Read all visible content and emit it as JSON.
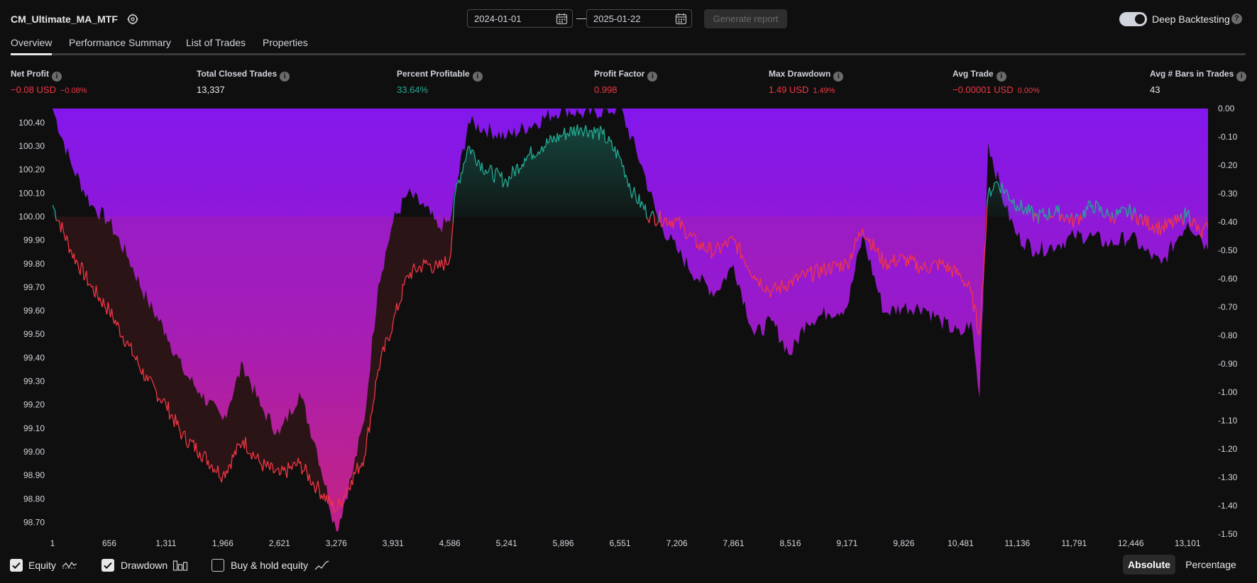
{
  "header": {
    "strategy_name": "CM_Ultimate_MA_MTF",
    "date_from": "2024-01-01",
    "date_separator": "—",
    "date_to": "2025-01-22",
    "generate_label": "Generate report",
    "deep_backtesting_label": "Deep Backtesting",
    "deep_backtesting_on": true
  },
  "tabs": [
    {
      "label": "Overview",
      "active": true
    },
    {
      "label": "Performance Summary",
      "active": false
    },
    {
      "label": "List of Trades",
      "active": false
    },
    {
      "label": "Properties",
      "active": false
    }
  ],
  "metrics": {
    "net_profit": {
      "label": "Net Profit",
      "value": "−0.08 USD",
      "sub": "−0.08%"
    },
    "total_closed_trades": {
      "label": "Total Closed Trades",
      "value": "13,337"
    },
    "percent_profitable": {
      "label": "Percent Profitable",
      "value": "33.64%"
    },
    "profit_factor": {
      "label": "Profit Factor",
      "value": "0.998"
    },
    "max_drawdown": {
      "label": "Max Drawdown",
      "value": "1.49 USD",
      "sub": "1.49%"
    },
    "avg_trade": {
      "label": "Avg Trade",
      "value": "−0.00001 USD",
      "sub": "0.00%"
    },
    "avg_bars": {
      "label": "Avg # Bars in Trades",
      "value": "43"
    }
  },
  "colors": {
    "equity_up": "#22ab94",
    "equity_down": "#f23645",
    "drawdown": "#8317ec",
    "background": "#0f0f0f"
  },
  "chart_data": {
    "type": "area",
    "left_axis_ticks": [
      "100.40",
      "100.30",
      "100.20",
      "100.10",
      "100.00",
      "99.90",
      "99.80",
      "99.70",
      "99.60",
      "99.50",
      "99.40",
      "99.30",
      "99.20",
      "99.10",
      "99.00",
      "98.90",
      "98.80",
      "98.70"
    ],
    "right_axis_ticks": [
      "0.00",
      "-0.10",
      "-0.20",
      "-0.30",
      "-0.40",
      "-0.50",
      "-0.60",
      "-0.70",
      "-0.80",
      "-0.90",
      "-1.00",
      "-1.10",
      "-1.20",
      "-1.30",
      "-1.40",
      "-1.50"
    ],
    "x_ticks": [
      "1",
      "656",
      "1,311",
      "1,966",
      "2,621",
      "3,276",
      "3,931",
      "4,586",
      "5,241",
      "5,896",
      "6,551",
      "7,206",
      "7,861",
      "8,516",
      "9,171",
      "9,826",
      "10,481",
      "11,136",
      "11,791",
      "12,446",
      "13,101"
    ],
    "equity_ylim": [
      98.65,
      100.46
    ],
    "drawdown_ylim": [
      -1.5,
      0
    ],
    "baseline": 100.0,
    "series": [
      {
        "name": "Equity",
        "x": [
          1,
          220,
          450,
          656,
          880,
          1100,
          1311,
          1500,
          1700,
          1966,
          2200,
          2400,
          2621,
          2850,
          3050,
          3276,
          3450,
          3600,
          3760,
          3931,
          4100,
          4300,
          4450,
          4586,
          4650,
          4800,
          5000,
          5241,
          5450,
          5650,
          5896,
          6100,
          6350,
          6551,
          6700,
          6900,
          7206,
          7450,
          7650,
          7861,
          8100,
          8300,
          8516,
          8700,
          8950,
          9171,
          9350,
          9600,
          9826,
          10050,
          10250,
          10481,
          10600,
          10700,
          10800,
          10900,
          11136,
          11350,
          11600,
          11791,
          12000,
          12200,
          12446,
          12600,
          12800,
          13000,
          13101,
          13250,
          13337
        ],
        "y": [
          100.05,
          99.85,
          99.7,
          99.6,
          99.45,
          99.3,
          99.2,
          99.07,
          99.0,
          98.9,
          99.05,
          98.95,
          98.9,
          98.95,
          98.85,
          98.75,
          98.88,
          98.98,
          99.35,
          99.55,
          99.75,
          99.8,
          99.78,
          99.82,
          100.1,
          100.3,
          100.2,
          100.15,
          100.25,
          100.3,
          100.35,
          100.38,
          100.35,
          100.25,
          100.1,
          100.0,
          99.98,
          99.88,
          99.85,
          99.9,
          99.75,
          99.68,
          99.72,
          99.75,
          99.78,
          99.8,
          99.95,
          99.8,
          99.82,
          99.78,
          99.8,
          99.75,
          99.68,
          99.5,
          100.1,
          100.15,
          100.05,
          100.0,
          100.02,
          99.98,
          100.05,
          100.0,
          100.02,
          99.98,
          99.95,
          99.98,
          100.02,
          99.92,
          99.95
        ]
      },
      {
        "name": "Drawdown",
        "x": [
          1,
          220,
          450,
          656,
          880,
          1100,
          1311,
          1500,
          1700,
          1966,
          2200,
          2400,
          2621,
          2850,
          3050,
          3276,
          3450,
          3600,
          3760,
          3931,
          4100,
          4300,
          4450,
          4586,
          4800,
          5241,
          5896,
          6100,
          6551,
          6800,
          7000,
          7206,
          7450,
          7650,
          7861,
          8100,
          8300,
          8516,
          8700,
          8950,
          9171,
          9350,
          9600,
          9826,
          10050,
          10250,
          10481,
          10600,
          10700,
          10800,
          11000,
          11136,
          11350,
          11600,
          11791,
          12000,
          12200,
          12446,
          12600,
          12800,
          13000,
          13101,
          13250,
          13337
        ],
        "y": [
          0.0,
          -0.2,
          -0.34,
          -0.4,
          -0.53,
          -0.68,
          -0.79,
          -0.92,
          -1.0,
          -1.1,
          -0.9,
          -1.05,
          -1.15,
          -1.0,
          -1.2,
          -1.49,
          -1.3,
          -1.1,
          -0.62,
          -0.4,
          -0.3,
          -0.35,
          -0.42,
          -0.4,
          -0.05,
          -0.1,
          0.0,
          -0.02,
          0.0,
          -0.2,
          -0.4,
          -0.5,
          -0.6,
          -0.65,
          -0.55,
          -0.8,
          -0.75,
          -0.87,
          -0.75,
          -0.72,
          -0.7,
          -0.45,
          -0.72,
          -0.7,
          -0.7,
          -0.75,
          -0.8,
          -0.75,
          -1.02,
          -0.12,
          -0.35,
          -0.45,
          -0.5,
          -0.48,
          -0.45,
          -0.45,
          -0.48,
          -0.45,
          -0.5,
          -0.55,
          -0.45,
          -0.4,
          -0.45,
          -0.5
        ]
      }
    ],
    "xlim": [
      1,
      13337
    ]
  },
  "bottom": {
    "equity_label": "Equity",
    "equity_checked": true,
    "drawdown_label": "Drawdown",
    "drawdown_checked": true,
    "buyhold_label": "Buy & hold equity",
    "buyhold_checked": false,
    "absolute_label": "Absolute",
    "percentage_label": "Percentage",
    "mode": "Absolute"
  }
}
